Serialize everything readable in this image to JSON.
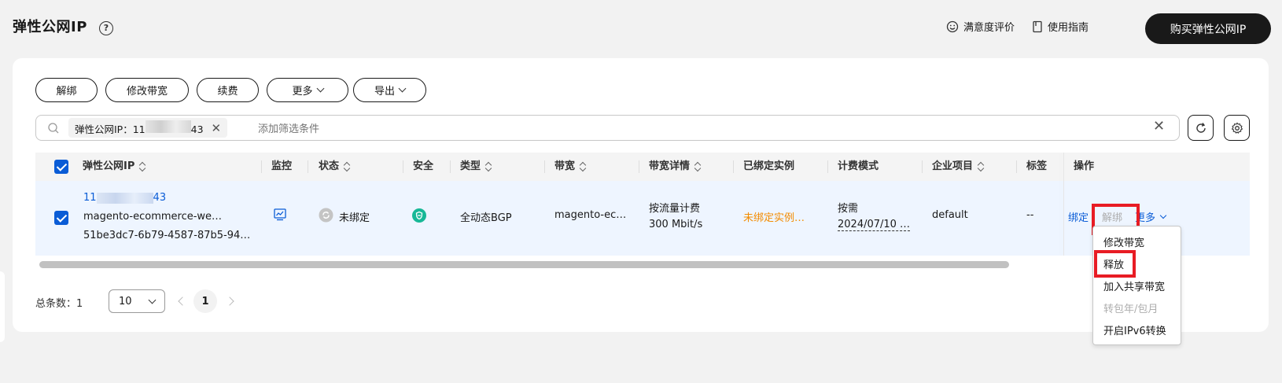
{
  "header": {
    "title": "弹性公网IP",
    "satisfaction_label": "满意度评价",
    "guide_label": "使用指南",
    "buy_label": "购买弹性公网IP"
  },
  "toolbar": {
    "unbind_label": "解绑",
    "modify_bandwidth_label": "修改带宽",
    "renew_label": "续费",
    "more_label": "更多",
    "export_label": "导出"
  },
  "search": {
    "tag_key": "弹性公网IP：",
    "tag_value_prefix": "11",
    "tag_value_suffix": "43",
    "placeholder": "添加筛选条件"
  },
  "table": {
    "columns": [
      "弹性公网IP",
      "监控",
      "状态",
      "安全",
      "类型",
      "带宽",
      "带宽详情",
      "已绑定实例",
      "计费模式",
      "企业项目",
      "标签",
      "操作"
    ],
    "row": {
      "ip_prefix": "11",
      "ip_suffix": "43",
      "name": "magento-ecommerce-we…",
      "id": "51be3dc7-6b79-4587-87b5-94…",
      "status": "未绑定",
      "type": "全动态BGP",
      "bandwidth": "magento-ec…",
      "bandwidth_detail_1": "按流量计费",
      "bandwidth_detail_2": "300 Mbit/s",
      "bound_instance": "未绑定实例…",
      "billing_1": "按需",
      "billing_2": "2024/07/10 …",
      "enterprise_project": "default",
      "tags": "--",
      "op_bind": "绑定",
      "op_unbind": "解绑",
      "op_more": "更多"
    }
  },
  "dropdown": {
    "items": [
      {
        "label": "修改带宽",
        "disabled": false
      },
      {
        "label": "释放",
        "disabled": false
      },
      {
        "label": "加入共享带宽",
        "disabled": false
      },
      {
        "label": "转包年/包月",
        "disabled": true
      },
      {
        "label": "开启IPv6转换",
        "disabled": false
      }
    ]
  },
  "pagination": {
    "total_label": "总条数：",
    "total": "1",
    "page_size": "10",
    "current_page": "1"
  },
  "colors": {
    "primary": "#0a5cd6",
    "highlight": "#e81c24",
    "warning": "#f38b00",
    "security": "#17b897"
  }
}
